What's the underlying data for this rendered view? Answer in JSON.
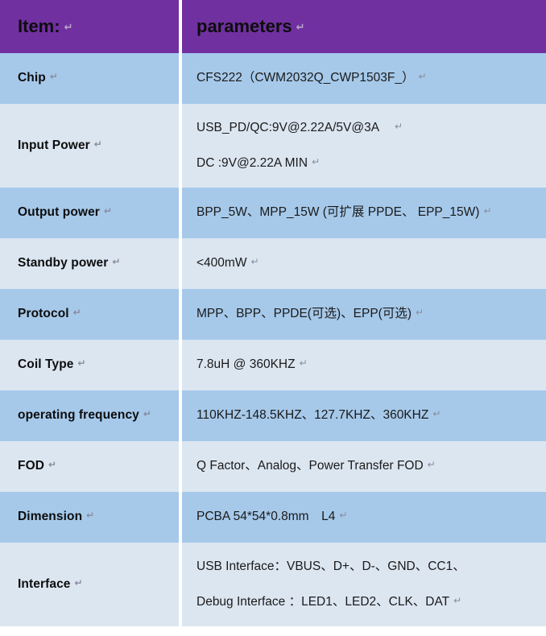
{
  "table": {
    "header": {
      "label_column": "Item:",
      "value_column": "parameters",
      "background_color": "#7030A0",
      "text_color": "#0d0d0d"
    },
    "paragraph_mark": "↵",
    "band_colors": {
      "odd": "#a6c9ea",
      "even": "#dce6f1"
    },
    "rows": [
      {
        "label": "Chip",
        "lines": [
          "CFS222（CWM2032Q_CWP1503F_）"
        ]
      },
      {
        "label": "Input Power",
        "lines": [
          "USB_PD/QC:9V@2.22A/5V@3A",
          "DC :9V@2.22A MIN"
        ]
      },
      {
        "label": "Output power",
        "lines": [
          "BPP_5W、MPP_15W (可扩展 PPDE、 EPP_15W)"
        ]
      },
      {
        "label": "Standby power",
        "lines": [
          "<400mW"
        ]
      },
      {
        "label": "Protocol",
        "lines": [
          "MPP、BPP、PPDE(可选)、EPP(可选)"
        ]
      },
      {
        "label": "Coil Type",
        "lines": [
          "7.8uH @ 360KHZ"
        ]
      },
      {
        "label": "operating frequency",
        "lines": [
          "110KHZ-148.5KHZ、127.7KHZ、360KHZ"
        ]
      },
      {
        "label": "FOD",
        "lines": [
          "Q Factor、Analog、Power Transfer FOD"
        ]
      },
      {
        "label": "Dimension",
        "lines": [
          "PCBA 54*54*0.8mm　L4"
        ]
      },
      {
        "label": "Interface",
        "lines": [
          "USB Interface：VBUS、D+、D-、GND、CC1、",
          "Debug Interface ：LED1、LED2、CLK、DAT"
        ]
      }
    ]
  }
}
